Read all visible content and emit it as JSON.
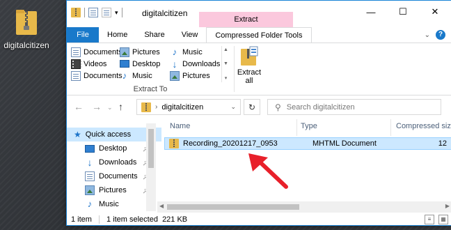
{
  "desktop": {
    "icon_label": "digitalcitizen"
  },
  "window": {
    "title": "digitalcitizen",
    "context_tab_header": "Extract",
    "controls": {
      "minimize": "—",
      "maximize": "☐",
      "close": "✕"
    }
  },
  "tabs": {
    "file": "File",
    "home": "Home",
    "share": "Share",
    "view": "View",
    "compressed": "Compressed Folder Tools"
  },
  "ribbon": {
    "destinations": [
      [
        "Documents",
        "Pictures",
        "Music"
      ],
      [
        "Videos",
        "Desktop",
        "Downloads"
      ],
      [
        "Documents",
        "Music",
        "Pictures"
      ]
    ],
    "group_label": "Extract To",
    "extract_all": "Extract\nall"
  },
  "address": {
    "path": "digitalcitizen",
    "search_placeholder": "Search digitalcitizen"
  },
  "nav": {
    "quick_access": "Quick access",
    "items": [
      "Desktop",
      "Downloads",
      "Documents",
      "Pictures",
      "Music"
    ]
  },
  "columns": {
    "name": "Name",
    "type": "Type",
    "size": "Compressed size"
  },
  "files": [
    {
      "name": "Recording_20201217_0953",
      "type": "MHTML Document",
      "size": "12"
    }
  ],
  "status": {
    "count": "1 item",
    "selection": "1 item selected  221 KB"
  },
  "colors": {
    "accent": "#1979ca",
    "context_tab": "#fbc8dd",
    "selection": "#cce8ff",
    "arrow": "#e8202a"
  }
}
